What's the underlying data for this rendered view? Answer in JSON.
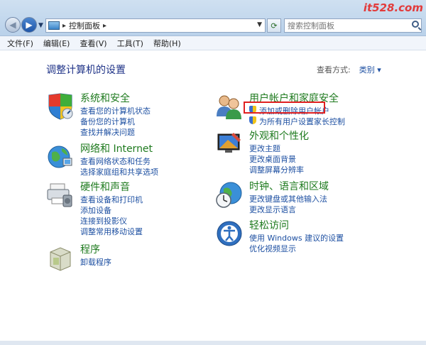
{
  "window": {
    "address": {
      "segments": [
        "控制面板"
      ]
    },
    "search": {
      "placeholder": "搜索控制面板"
    },
    "watermark": "it528.com"
  },
  "menubar": {
    "items": [
      "文件(F)",
      "编辑(E)",
      "查看(V)",
      "工具(T)",
      "帮助(H)"
    ]
  },
  "main": {
    "title": "调整计算机的设置",
    "view_by": {
      "label": "查看方式:",
      "value": "类别"
    }
  },
  "categories": [
    {
      "title": "系统和安全",
      "links": [
        "查看您的计算机状态",
        "备份您的计算机",
        "查找并解决问题"
      ]
    },
    {
      "title": "网络和 Internet",
      "links": [
        "查看网络状态和任务",
        "选择家庭组和共享选项"
      ]
    },
    {
      "title": "硬件和声音",
      "links": [
        "查看设备和打印机",
        "添加设备",
        "连接到投影仪",
        "调整常用移动设置"
      ]
    },
    {
      "title": "程序",
      "links": [
        "卸载程序"
      ]
    },
    {
      "title": "用户帐户和家庭安全",
      "links": [
        "添加或删除用户帐户",
        "为所有用户设置家长控制"
      ]
    },
    {
      "title": "外观和个性化",
      "links": [
        "更改主题",
        "更改桌面背景",
        "调整屏幕分辨率"
      ]
    },
    {
      "title": "时钟、语言和区域",
      "links": [
        "更改键盘或其他输入法",
        "更改显示语言"
      ]
    },
    {
      "title": "轻松访问",
      "links": [
        "使用 Windows 建议的设置",
        "优化视频显示"
      ]
    }
  ],
  "colors": {
    "category_title": "#1e7a1e",
    "link": "#1e50a2",
    "highlight_box": "#e02020"
  }
}
